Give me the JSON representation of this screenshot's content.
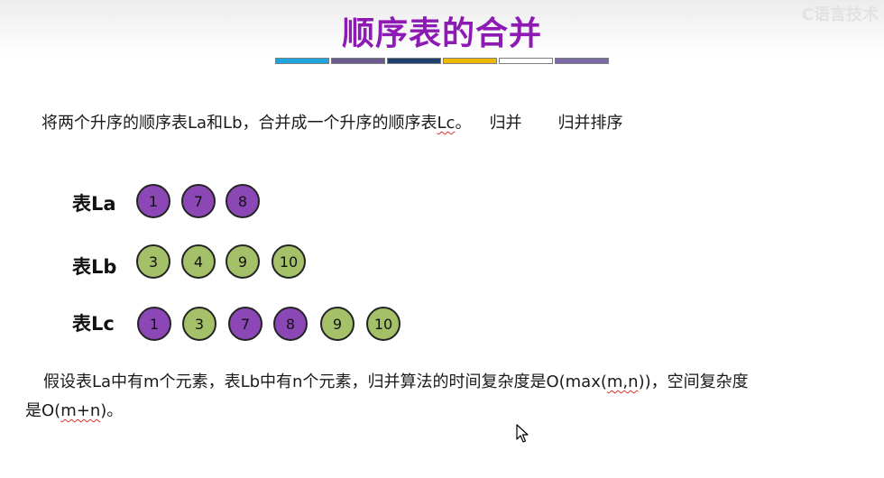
{
  "slide": {
    "title": "顺序表的合并",
    "watermark": "C语言技术",
    "colors": {
      "title": "#8e1ab5",
      "purple_node": "#8c47b6",
      "green_node": "#a4c068",
      "bar": [
        "#1fa4dc",
        "#6b5a8e",
        "#1f3f6e",
        "#f0b800",
        "#ffffff",
        "#7b6aa6"
      ]
    },
    "intro": {
      "part1": "将两个升序的顺序表La和Lb，合并成一个升序的顺序表",
      "lc": "Lc",
      "end": "。",
      "word1": "归并",
      "word2": "归并排序"
    },
    "rows": [
      {
        "label": "表La",
        "values": [
          "1",
          "7",
          "8"
        ]
      },
      {
        "label": "表Lb",
        "values": [
          "3",
          "4",
          "9",
          "10"
        ]
      },
      {
        "label": "表Lc",
        "values": [
          "1",
          "3",
          "7",
          "8",
          "9",
          "10"
        ]
      }
    ],
    "footer": {
      "l1_a": "假设表La中有m个元素，表Lb中有n个元素，归并算法的时间复杂度是O(max(",
      "l1_b": "m,n",
      "l1_c": "))，空间复杂度",
      "l2_a": "是O(",
      "l2_b": "m+n",
      "l2_c": ")。"
    }
  }
}
